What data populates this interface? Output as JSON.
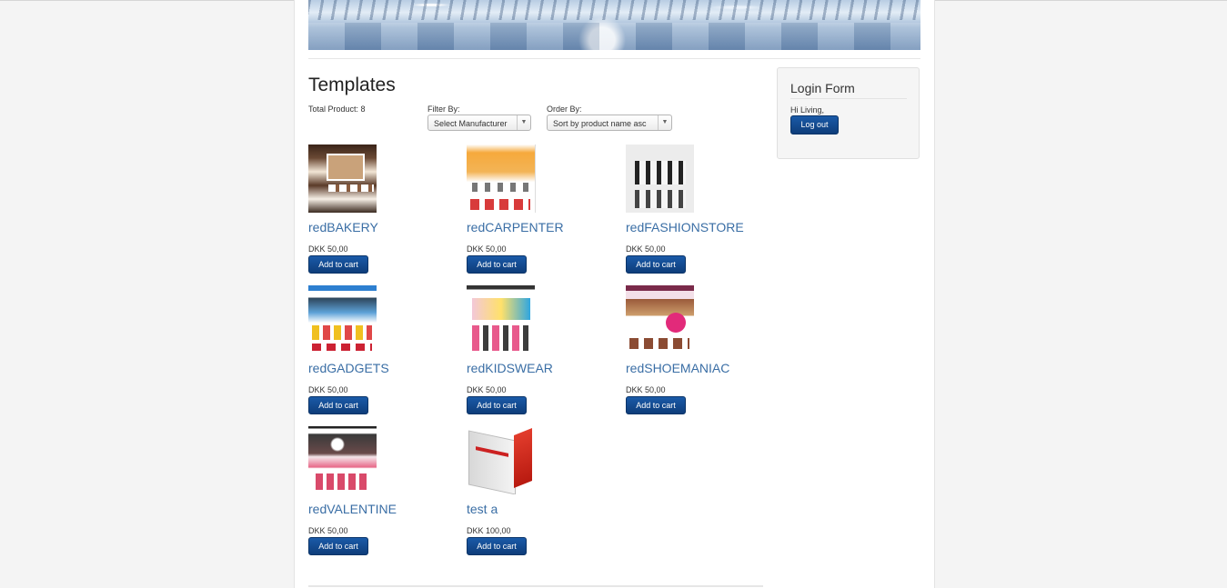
{
  "page": {
    "title": "Templates",
    "total_product": "Total Product: 8",
    "filter_label": "Filter By:",
    "filter_value": "Select Manufacturer",
    "order_label": "Order By:",
    "order_value": "Sort by product name asc",
    "select_arrow": "▼"
  },
  "products": [
    {
      "name": "redBAKERY",
      "price": "DKK 50,00",
      "cart_label": "Add to cart"
    },
    {
      "name": "redCARPENTER",
      "price": "DKK 50,00",
      "cart_label": "Add to cart"
    },
    {
      "name": "redFASHIONSTORE",
      "price": "DKK 50,00",
      "cart_label": "Add to cart"
    },
    {
      "name": "redGADGETS",
      "price": "DKK 50,00",
      "cart_label": "Add to cart"
    },
    {
      "name": "redKIDSWEAR",
      "price": "DKK 50,00",
      "cart_label": "Add to cart"
    },
    {
      "name": "redSHOEMANIAC",
      "price": "DKK 50,00",
      "cart_label": "Add to cart"
    },
    {
      "name": "redVALENTINE",
      "price": "DKK 50,00",
      "cart_label": "Add to cart"
    },
    {
      "name": "test a",
      "price": "DKK 100,00",
      "cart_label": "Add to cart"
    }
  ],
  "login": {
    "title": "Login Form",
    "greeting": "Hi Living,",
    "logout_label": "Log out"
  },
  "colors": {
    "link": "#3a6ea5",
    "button": "#0e3d7a"
  }
}
